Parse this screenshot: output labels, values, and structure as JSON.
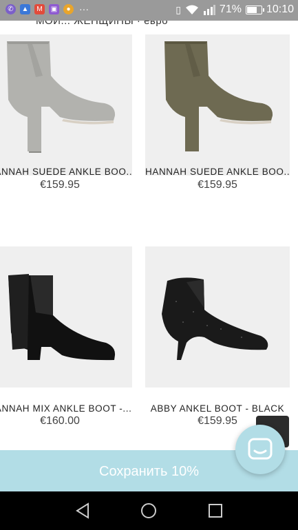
{
  "status_bar": {
    "notification_icons": [
      "viber-icon",
      "photos-icon",
      "gmail-icon",
      "gallery-icon",
      "chrome-icon"
    ],
    "more": "···",
    "battery": "71%",
    "battery_level": 0.71,
    "time": "10:10"
  },
  "header": {
    "breadcrumb": "МОИ... ЖЕНЩИНЫ · евро"
  },
  "products": [
    {
      "name": "HANNAH SUEDE ANKLE BOO...",
      "price": "€159.95",
      "color": "grey-suede"
    },
    {
      "name": "HANNAH SUEDE ANKLE BOO...",
      "price": "€159.95",
      "color": "olive-suede"
    },
    {
      "name": "HANNAH MIX ANKLE BOOT -...",
      "price": "€160.00",
      "color": "black-mix"
    },
    {
      "name": "ABBY ANKEL BOOT - BLACK",
      "price": "€159.95",
      "color": "black-glitter"
    }
  ],
  "promo": {
    "label": "Сохранить 10%"
  },
  "colors": {
    "banner": "#b2dde6",
    "status_bar": "#9a9a9a",
    "nav_bar": "#000000"
  }
}
